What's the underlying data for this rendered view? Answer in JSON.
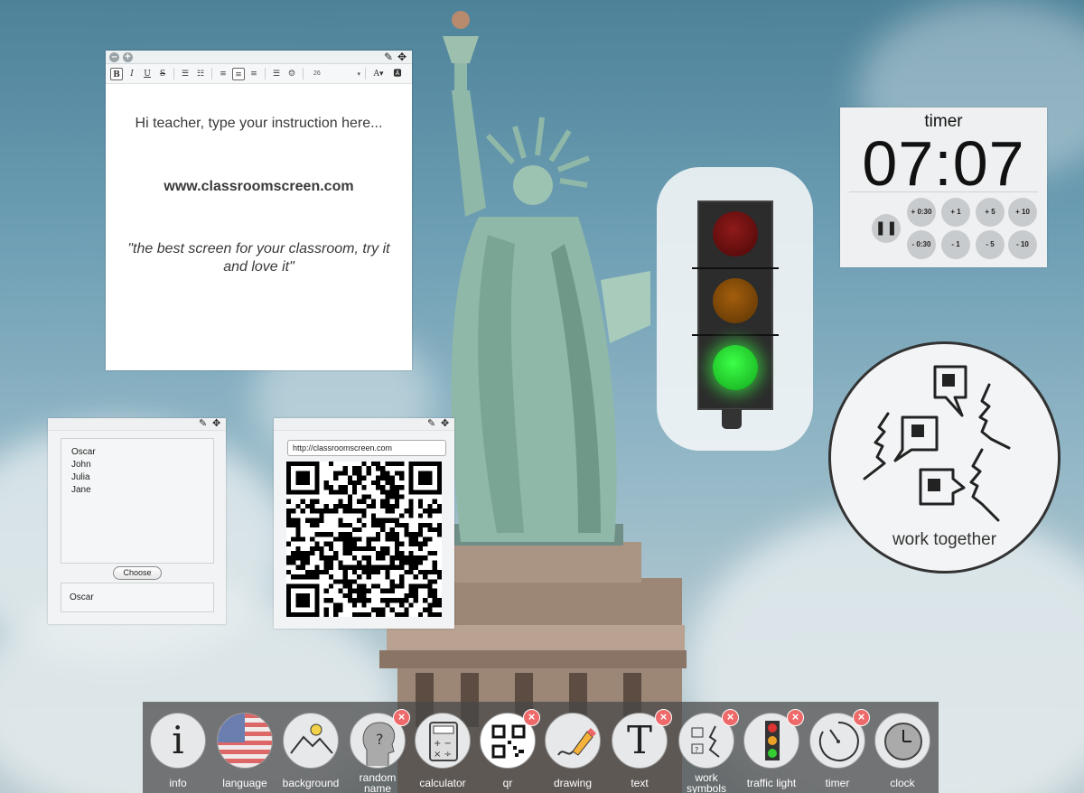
{
  "text_widget": {
    "font_size": "26",
    "line1": "Hi teacher, type your instruction here...",
    "line2": "www.classroomscreen.com",
    "line3": "\"the best screen for your classroom, try it and love it\""
  },
  "name_widget": {
    "names": [
      "Oscar",
      "John",
      "Julia",
      "Jane"
    ],
    "choose_label": "Choose",
    "result": "Oscar"
  },
  "qr_widget": {
    "url": "http://classroomscreen.com"
  },
  "traffic_light": {
    "active": "green"
  },
  "timer": {
    "title": "timer",
    "display": "07:07",
    "buttons_top": [
      "+ 0:30",
      "+ 1",
      "+ 5",
      "+ 10"
    ],
    "buttons_bottom": [
      "- 0:30",
      "- 1",
      "- 5",
      "- 10"
    ]
  },
  "work_symbols": {
    "label": "work together"
  },
  "dock": {
    "items": [
      {
        "label": "info",
        "icon": "info-icon",
        "closable": false
      },
      {
        "label": "language",
        "icon": "us-flag-icon",
        "closable": false
      },
      {
        "label": "background",
        "icon": "mountain-icon",
        "closable": false
      },
      {
        "label": "random name",
        "icon": "head-question-icon",
        "closable": true
      },
      {
        "label": "calculator",
        "icon": "calculator-icon",
        "closable": false
      },
      {
        "label": "qr",
        "icon": "qr-code-icon",
        "closable": true
      },
      {
        "label": "drawing",
        "icon": "pencil-icon",
        "closable": false
      },
      {
        "label": "text",
        "icon": "text-t-icon",
        "closable": true
      },
      {
        "label": "work symbols",
        "icon": "work-symbols-icon",
        "closable": true
      },
      {
        "label": "traffic light",
        "icon": "traffic-light-icon",
        "closable": true
      },
      {
        "label": "timer",
        "icon": "timer-icon",
        "closable": true
      },
      {
        "label": "clock",
        "icon": "clock-icon",
        "closable": false
      }
    ]
  },
  "colors": {
    "close_badge": "#ee6a6a",
    "traffic_green": "#3cff48"
  }
}
